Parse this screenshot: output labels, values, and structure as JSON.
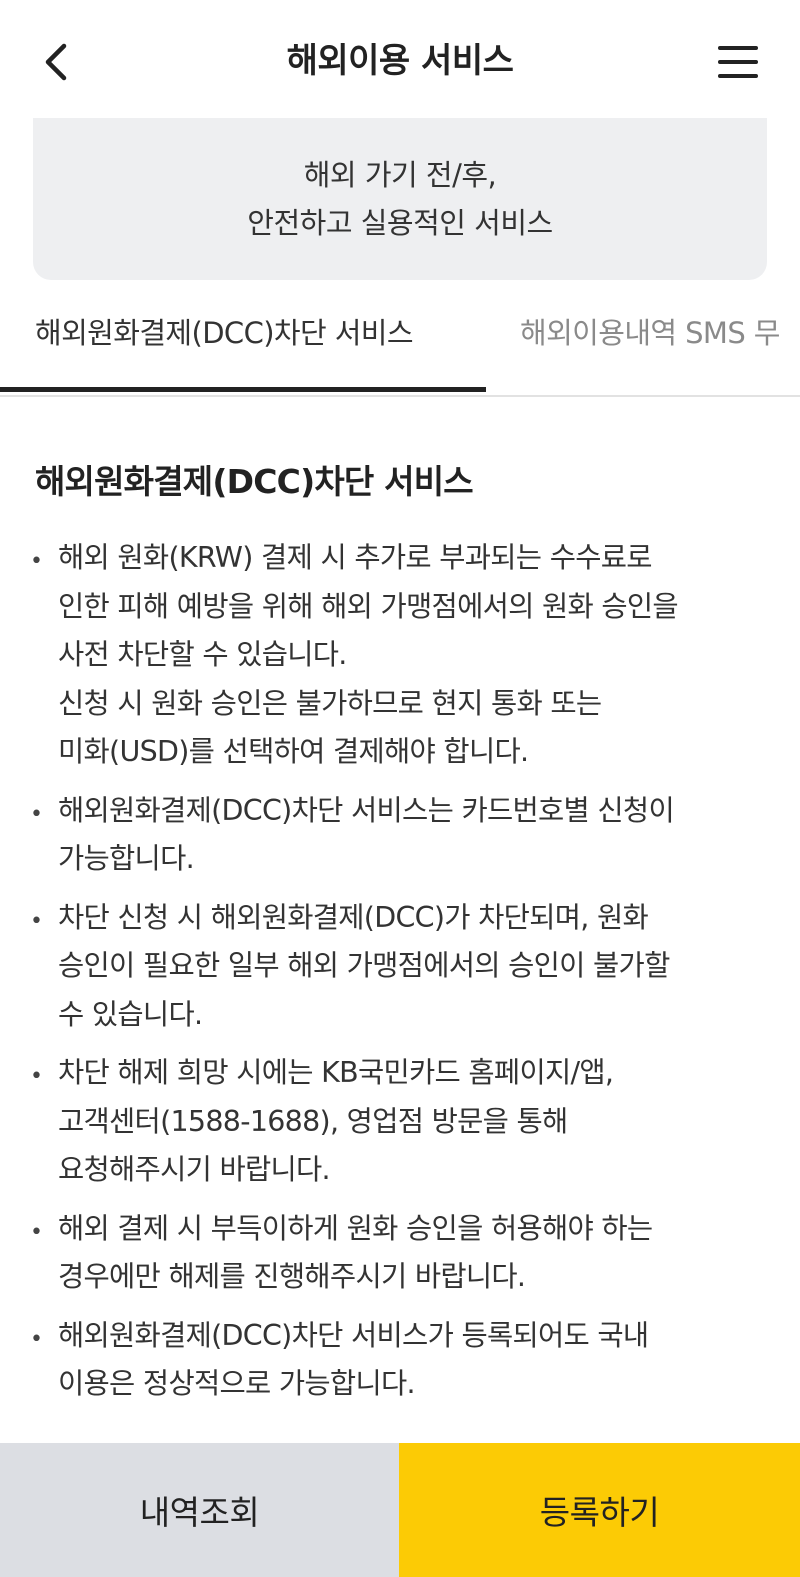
{
  "header": {
    "title": "해외이용 서비스",
    "back_icon": "chevron-left-icon",
    "menu_icon": "hamburger-menu-icon"
  },
  "banner": {
    "line1": "해외 가기 전/후,",
    "line2": "안전하고 실용적인 서비스"
  },
  "tabs": [
    {
      "label": "해외원화결제(DCC)차단 서비스",
      "active": true
    },
    {
      "label": "해외이용내역 SMS 무",
      "active": false
    }
  ],
  "section": {
    "title": "해외원화결제(DCC)차단 서비스",
    "bullets": [
      {
        "lines": [
          "해외 원화(KRW) 결제 시 추가로 부과되는 수수료로",
          "인한 피해 예방을 위해 해외 가맹점에서의 원화 승인을",
          "사전 차단할 수 있습니다.",
          "신청 시 원화 승인은 불가하므로 현지 통화 또는",
          "미화(USD)를 선택하여 결제해야 합니다."
        ]
      },
      {
        "lines": [
          "해외원화결제(DCC)차단 서비스는 카드번호별 신청이",
          "가능합니다."
        ]
      },
      {
        "lines": [
          "차단 신청 시 해외원화결제(DCC)가 차단되며, 원화",
          "승인이 필요한 일부 해외 가맹점에서의 승인이 불가할",
          "수 있습니다."
        ]
      },
      {
        "lines": [
          "차단 해제 희망 시에는 KB국민카드 홈페이지/앱,",
          "고객센터(1588-1688), 영업점 방문을 통해",
          "요청해주시기 바랍니다."
        ]
      },
      {
        "lines": [
          "해외 결제 시 부득이하게 원화 승인을 허용해야 하는",
          "경우에만 해제를 진행해주시기 바랍니다."
        ]
      },
      {
        "lines": [
          "해외원화결제(DCC)차단 서비스가 등록되어도 국내",
          "이용은 정상적으로 가능합니다."
        ]
      }
    ]
  },
  "footer": {
    "history_label": "내역조회",
    "register_label": "등록하기"
  },
  "colors": {
    "accent": "#fccb05",
    "secondary_button": "#dcdee3",
    "banner_bg": "#eeeff1",
    "active_tab_indicator": "#222222",
    "inactive_tab_text": "#8a8a8a"
  }
}
